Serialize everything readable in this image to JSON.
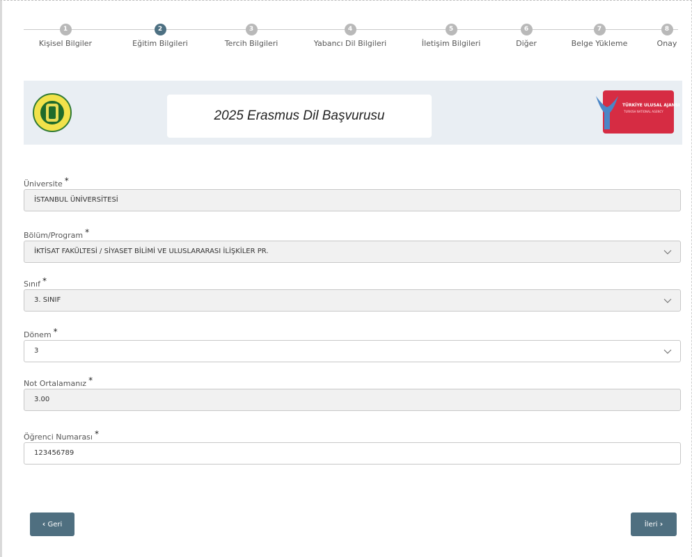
{
  "stepper": {
    "active_index": 1,
    "steps": [
      {
        "number": "1",
        "label": "Kişisel Bilgiler"
      },
      {
        "number": "2",
        "label": "Eğitim Bilgileri"
      },
      {
        "number": "3",
        "label": "Tercih Bilgileri"
      },
      {
        "number": "4",
        "label": "Yabancı Dil Bilgileri"
      },
      {
        "number": "5",
        "label": "İletişim Bilgileri"
      },
      {
        "number": "6",
        "label": "Diğer"
      },
      {
        "number": "7",
        "label": "Belge Yükleme"
      },
      {
        "number": "8",
        "label": "Onay"
      }
    ]
  },
  "banner": {
    "title": "2025 Erasmus Dil Başvurusu",
    "right_logo_text": "TÜRKİYE ULUSAL AJANSI",
    "right_logo_subtext": "TURKISH NATIONAL AGENCY"
  },
  "form": {
    "required_mark": "*",
    "universite": {
      "label": "Üniversite",
      "value": "İSTANBUL ÜNİVERSİTESİ"
    },
    "bolum": {
      "label": "Bölüm/Program",
      "value": "İKTİSAT FAKÜLTESİ / SİYASET BİLİMİ VE ULUSLARARASI İLİŞKİLER PR."
    },
    "sinif": {
      "label": "Sınıf",
      "value": "3. SINIF"
    },
    "donem": {
      "label": "Dönem",
      "value": "3"
    },
    "not": {
      "label": "Not Ortalamanız",
      "value": "3.00"
    },
    "ogrenci_no": {
      "label": "Öğrenci Numarası",
      "value": "123456789"
    }
  },
  "buttons": {
    "back_label": "Geri",
    "back_icon": "chevron-left-icon",
    "next_label": "İleri",
    "next_icon": "chevron-right-icon"
  },
  "colors": {
    "accent": "#4f6f80",
    "step_active": "#4d7082",
    "step_inactive": "#b9b9b9",
    "banner_bg": "#e9eef3",
    "agency_red": "#d62c43"
  }
}
